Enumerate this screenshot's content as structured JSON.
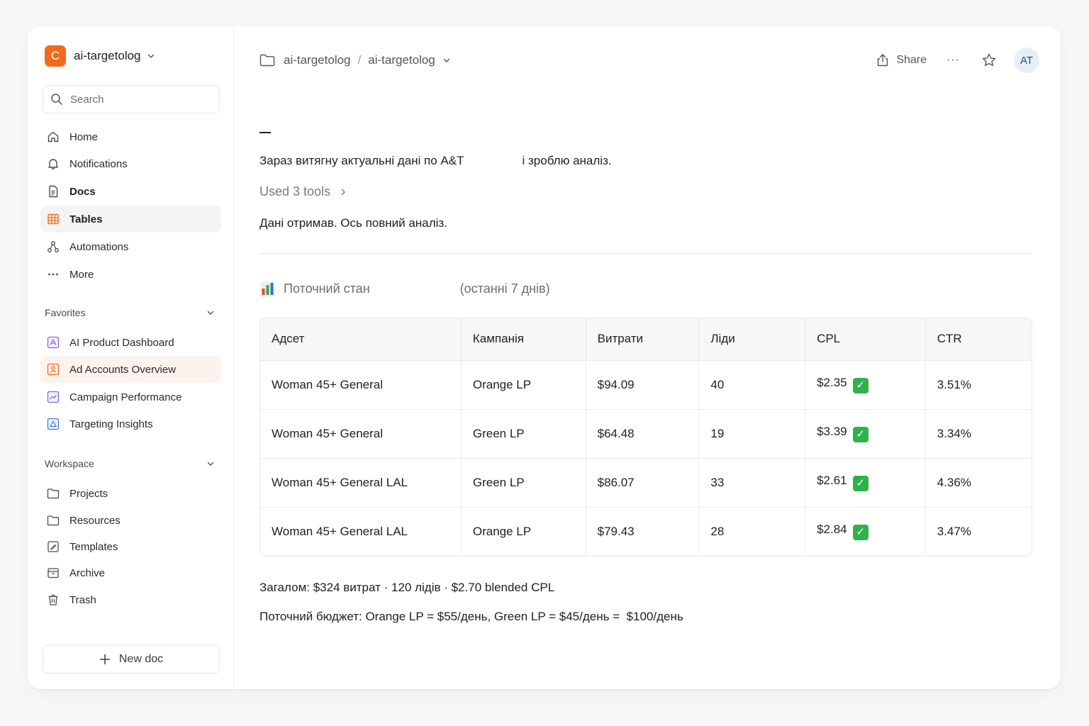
{
  "workspace": {
    "logo_letter": "C",
    "name": "ai-targetolog",
    "logo_color": "#f26a1b"
  },
  "search": {
    "placeholder": "Search"
  },
  "nav": [
    {
      "label": "Home",
      "icon": "home-icon"
    },
    {
      "label": "Notifications",
      "icon": "bell-icon"
    },
    {
      "label": "Docs",
      "icon": "doc-icon"
    },
    {
      "label": "Tables",
      "icon": "table-icon"
    },
    {
      "label": "Automations",
      "icon": "automation-icon"
    },
    {
      "label": "More",
      "icon": "more-icon"
    }
  ],
  "favorites": {
    "title": "Favorites",
    "items": [
      {
        "label": "AI Product Dashboard",
        "icon": "dashboard-doc-icon"
      },
      {
        "label": "Ad Accounts Overview",
        "icon": "dashboard-doc-icon"
      },
      {
        "label": "Campaign Performance",
        "icon": "dashboard-doc-icon"
      },
      {
        "label": "Targeting Insights",
        "icon": "dashboard-doc-icon"
      }
    ]
  },
  "workspace_section": {
    "title": "Workspace",
    "items": [
      {
        "label": "Projects",
        "icon": "folder-icon"
      },
      {
        "label": "Resources",
        "icon": "folder-icon"
      },
      {
        "label": "Templates",
        "icon": "template-icon"
      },
      {
        "label": "Archive",
        "icon": "archive-icon"
      },
      {
        "label": "Trash",
        "icon": "trash-icon"
      }
    ]
  },
  "new_doc": {
    "label": "New doc"
  },
  "breadcrumb": {
    "root": "ai-targetolog",
    "separator": "/",
    "current": "ai-targetolog"
  },
  "topbar": {
    "share_label": "Share",
    "more_label": "···",
    "avatar_initials": "AT"
  },
  "message": {
    "dash": "—",
    "line1_a": "Зараз витягну актуальні дані по A&T",
    "line1_b": "і зроблю аналіз.",
    "tools_label": "Used 3 tools",
    "line2": "Дані отримав. Ось повний аналіз."
  },
  "section": {
    "emoji": "📊",
    "title": "Поточний стан",
    "period": "(останні 7 днів)"
  },
  "table": {
    "headers": [
      "Адсет",
      "Кампанія",
      "Витрати",
      "Ліди",
      "CPL",
      "CTR"
    ],
    "rows": [
      [
        "Woman 45+ General",
        "Orange LP",
        "$94.09",
        "40",
        "$2.35",
        "3.51%"
      ],
      [
        "Woman 45+ General",
        "Green LP",
        "$64.48",
        "19",
        "$3.39",
        "3.34%"
      ],
      [
        "Woman 45+ General LAL",
        "Green LP",
        "$86.07",
        "33",
        "$2.61",
        "4.36%"
      ],
      [
        "Woman 45+ General LAL",
        "Orange LP",
        "$79.43",
        "28",
        "$2.84",
        "3.47%"
      ]
    ],
    "check_mark": "✓",
    "check_color": "#2fb24c"
  },
  "summary": {
    "line1": "Загалом: $324 витрат · 120 лідів · $2.70 blended CPL",
    "line2": "Поточний бюджет: Orange LP = $55/день, Green LP = $45/день =  $100/день"
  }
}
